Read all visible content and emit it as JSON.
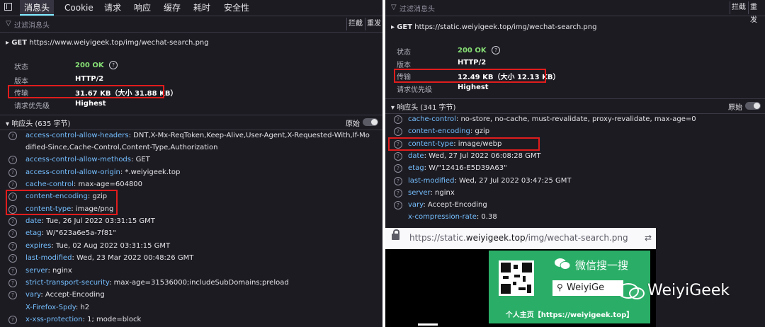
{
  "left": {
    "tabs": [
      "消息头",
      "Cookie",
      "请求",
      "响应",
      "缓存",
      "耗时",
      "安全性"
    ],
    "filter_placeholder": "过滤消息头",
    "block_label": "拦截",
    "resend_label": "重发",
    "request": {
      "method": "GET",
      "url": "https://www.weiyigeek.top/img/wechat-search.png"
    },
    "status_label": "状态",
    "status_code": "200",
    "status_text": "OK",
    "version_label": "版本",
    "version": "HTTP/2",
    "transfer_label": "传输",
    "transfer": "31.67 KB（大小 31.88 KB）",
    "priority_label": "请求优先级",
    "priority": "Highest",
    "response_headers_label": "响应头 (635 字节)",
    "raw_label": "原始",
    "headers": [
      {
        "name": "access-control-allow-headers",
        "value": "DNT,X-Mx-ReqToken,Keep-Alive,User-Agent,X-Requested-With,If-Mo",
        "value2": "dified-Since,Cache-Control,Content-Type,Authorization"
      },
      {
        "name": "access-control-allow-methods",
        "value": "GET"
      },
      {
        "name": "access-control-allow-origin",
        "value": "*.weiyigeek.top"
      },
      {
        "name": "cache-control",
        "value": "max-age=604800"
      },
      {
        "name": "content-encoding",
        "value": "gzip"
      },
      {
        "name": "content-type",
        "value": "image/png"
      },
      {
        "name": "date",
        "value": "Tue, 26 Jul 2022 03:31:15 GMT"
      },
      {
        "name": "etag",
        "value": "W/\"623a6e5a-7f81\""
      },
      {
        "name": "expires",
        "value": "Tue, 02 Aug 2022 03:31:15 GMT"
      },
      {
        "name": "last-modified",
        "value": "Wed, 23 Mar 2022 00:48:26 GMT"
      },
      {
        "name": "server",
        "value": "nginx"
      },
      {
        "name": "strict-transport-security",
        "value": "max-age=31536000;includeSubDomains;preload"
      },
      {
        "name": "vary",
        "value": "Accept-Encoding"
      },
      {
        "name": "X-Firefox-Spdy",
        "value": "h2"
      },
      {
        "name": "x-xss-protection",
        "value": "1; mode=block"
      }
    ]
  },
  "right": {
    "filter_placeholder": "过滤消息头",
    "block_label": "拦截",
    "resend_label": "重发",
    "request": {
      "method": "GET",
      "url": "https://static.weiyigeek.top/img/wechat-search.png"
    },
    "status_label": "状态",
    "status_code": "200",
    "status_text": "OK",
    "version_label": "版本",
    "version": "HTTP/2",
    "transfer_label": "传输",
    "transfer": "12.49 KB（大小 12.13 KB）",
    "priority_label": "请求优先级",
    "priority": "Highest",
    "response_headers_label": "响应头 (341 字节)",
    "raw_label": "原始",
    "headers": [
      {
        "name": "cache-control",
        "value": "no-store, no-cache, must-revalidate, proxy-revalidate, max-age=0"
      },
      {
        "name": "content-encoding",
        "value": "gzip"
      },
      {
        "name": "content-type",
        "value": "image/webp"
      },
      {
        "name": "date",
        "value": "Wed, 27 Jul 2022 06:08:28 GMT"
      },
      {
        "name": "etag",
        "value": "W/\"12416-E5D39A63\""
      },
      {
        "name": "last-modified",
        "value": "Wed, 27 Jul 2022 03:47:25 GMT"
      },
      {
        "name": "server",
        "value": "nginx"
      },
      {
        "name": "vary",
        "value": "Accept-Encoding"
      },
      {
        "name": "x-compression-rate",
        "value": "0.38"
      }
    ]
  },
  "browser": {
    "url_prefix": "https://static.",
    "url_domain": "weiyigeek.top",
    "url_suffix": "/img/wechat-search.png"
  },
  "banner": {
    "title": "微信搜一搜",
    "search_text": "WeiyiGe",
    "footer": "个人主页【https://weiyigeek.top】",
    "bg_color": "#2aae67"
  },
  "watermark": "WeiyiGeek",
  "colors": {
    "header_name": "#75bfff",
    "status_ok": "#86de74",
    "highlight_box": "#e01c1c",
    "panel_bg": "#1c1b22"
  }
}
